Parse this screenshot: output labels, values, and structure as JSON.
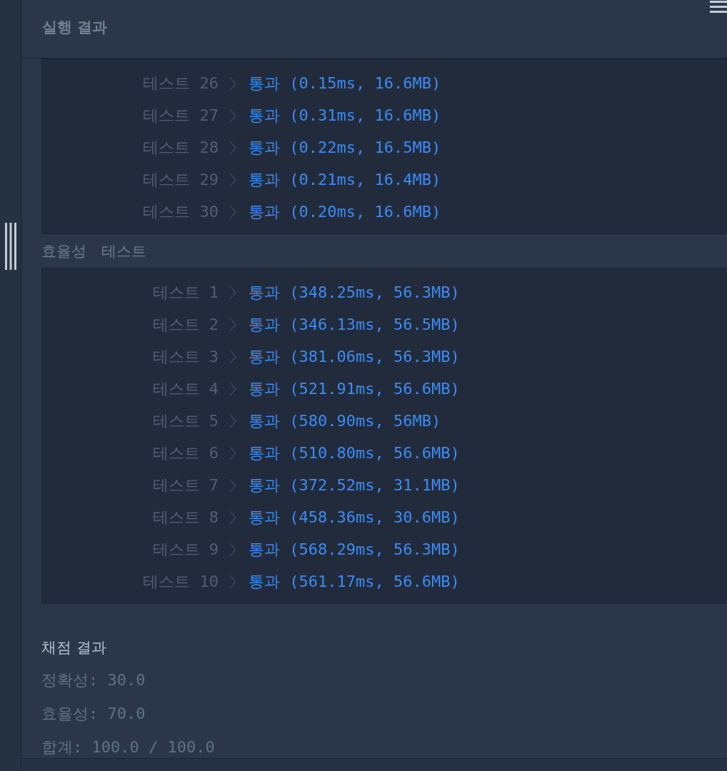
{
  "panel": {
    "title": "실행 결과"
  },
  "accuracy_tests": {
    "rows": [
      {
        "label": "테스트 26",
        "result": "통과 (0.15ms, 16.6MB)"
      },
      {
        "label": "테스트 27",
        "result": "통과 (0.31ms, 16.6MB)"
      },
      {
        "label": "테스트 28",
        "result": "통과 (0.22ms, 16.5MB)"
      },
      {
        "label": "테스트 29",
        "result": "통과 (0.21ms, 16.4MB)"
      },
      {
        "label": "테스트 30",
        "result": "통과 (0.20ms, 16.6MB)"
      }
    ]
  },
  "efficiency_tests": {
    "title": "효율성 테스트",
    "rows": [
      {
        "label": "테스트 1",
        "result": "통과 (348.25ms, 56.3MB)"
      },
      {
        "label": "테스트 2",
        "result": "통과 (346.13ms, 56.5MB)"
      },
      {
        "label": "테스트 3",
        "result": "통과 (381.06ms, 56.3MB)"
      },
      {
        "label": "테스트 4",
        "result": "통과 (521.91ms, 56.6MB)"
      },
      {
        "label": "테스트 5",
        "result": "통과 (580.90ms, 56MB)"
      },
      {
        "label": "테스트 6",
        "result": "통과 (510.80ms, 56.6MB)"
      },
      {
        "label": "테스트 7",
        "result": "통과 (372.52ms, 31.1MB)"
      },
      {
        "label": "테스트 8",
        "result": "통과 (458.36ms, 30.6MB)"
      },
      {
        "label": "테스트 9",
        "result": "통과 (568.29ms, 56.3MB)"
      },
      {
        "label": "테스트 10",
        "result": "통과 (561.17ms, 56.6MB)"
      }
    ]
  },
  "grading": {
    "title": "채점 결과",
    "lines": [
      "정확성: 30.0",
      "효율성: 70.0",
      "합계: 100.0 / 100.0"
    ]
  }
}
